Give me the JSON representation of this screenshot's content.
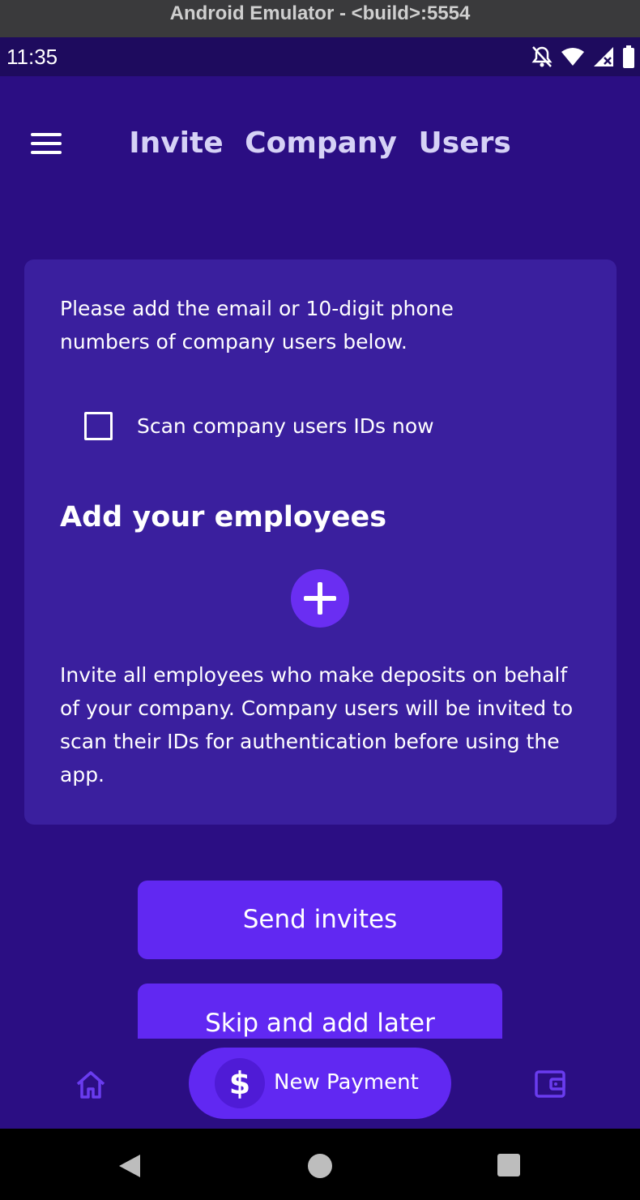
{
  "emulator": {
    "title": "Android Emulator - <build>:5554"
  },
  "status_bar": {
    "time": "11:35",
    "icons": [
      "bell-off-icon",
      "wifi-icon",
      "signal-icon",
      "battery-icon"
    ]
  },
  "header": {
    "title": "Invite Company Users",
    "menu_icon": "hamburger-menu-icon"
  },
  "card": {
    "intro": "Please add the email or 10-digit phone numbers of company users below.",
    "scan_checkbox_label": "Scan company users IDs now",
    "scan_checkbox_checked": false,
    "add_heading": "Add your employees",
    "add_icon": "plus-icon",
    "info": "Invite all employees who make deposits on behalf of your company. Company users will be invited to scan their IDs for authentication before using the app."
  },
  "actions": {
    "send_invites": "Send invites",
    "skip": "Skip and add later"
  },
  "bottom_nav": {
    "home_icon": "home-icon",
    "wallet_icon": "wallet-icon",
    "new_payment_label": "New Payment",
    "new_payment_symbol": "$"
  },
  "colors": {
    "background": "#2b0e83",
    "card": "#3a1f9e",
    "accent": "#6128f2",
    "text": "#ffffff"
  }
}
